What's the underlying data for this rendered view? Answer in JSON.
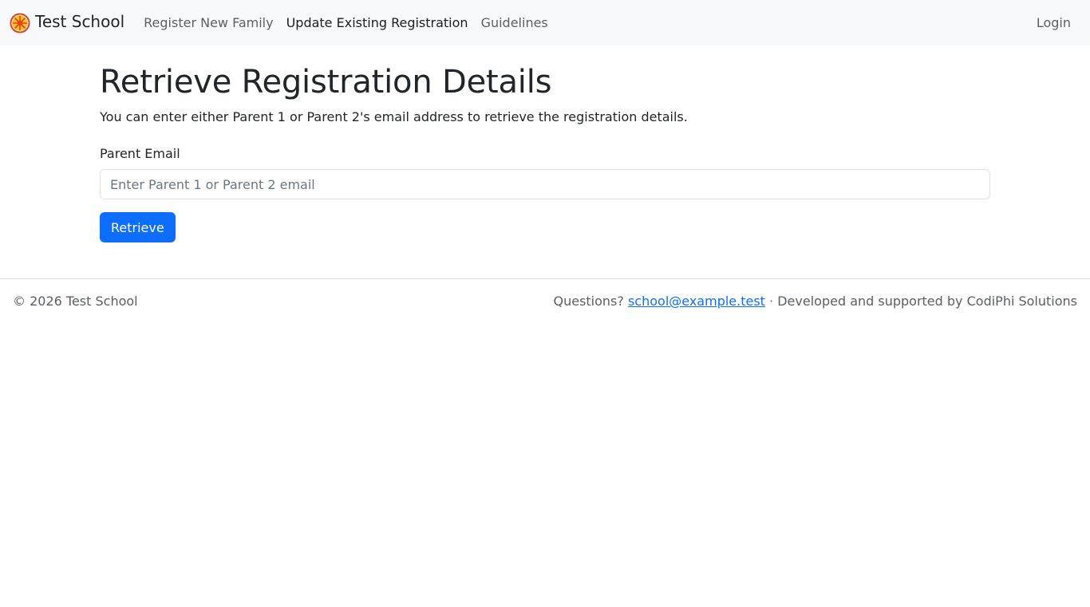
{
  "brand": {
    "name": "Test School",
    "logo_icon": "sun-icon"
  },
  "nav": {
    "links": [
      {
        "label": "Register New Family",
        "active": false
      },
      {
        "label": "Update Existing Registration",
        "active": true
      },
      {
        "label": "Guidelines",
        "active": false
      }
    ],
    "login_label": "Login"
  },
  "main": {
    "title": "Retrieve Registration Details",
    "description": "You can enter either Parent 1 or Parent 2's email address to retrieve the registration details.",
    "email_label": "Parent Email",
    "email_value": "",
    "email_placeholder": "Enter Parent 1 or Parent 2 email",
    "submit_label": "Retrieve"
  },
  "footer": {
    "copyright": "© 2026 Test School",
    "questions_label": "Questions?",
    "contact_email": "school@example.test",
    "separator": "·",
    "credit": "Developed and supported by CodiPhi Solutions"
  },
  "colors": {
    "primary": "#0d6efd",
    "navbar_bg": "#f8f9fa",
    "logo_red": "#e8401c",
    "logo_yellow": "#f7c21e"
  }
}
